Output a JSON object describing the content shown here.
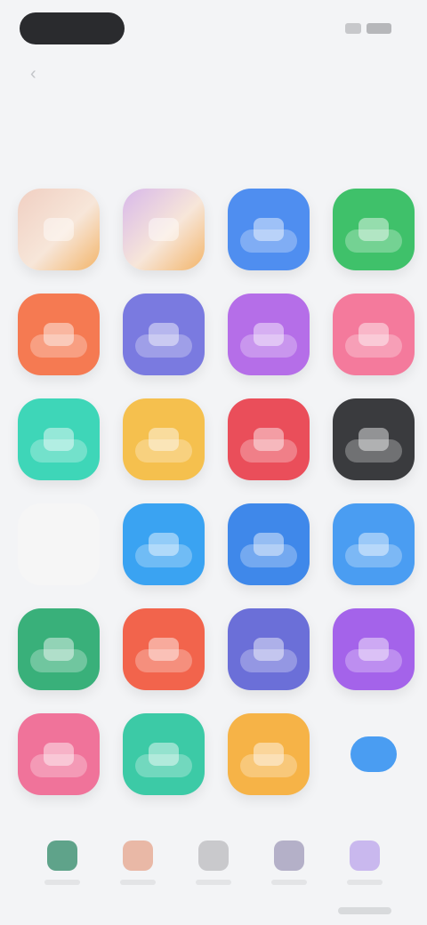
{
  "page": {
    "title": ""
  },
  "tiles": [
    {
      "name": "app-tile-1-1",
      "color": "#f0cfc2",
      "style": "illustrated"
    },
    {
      "name": "app-tile-1-2",
      "color": "#d8b8ea",
      "style": "illustrated"
    },
    {
      "name": "app-tile-1-3",
      "color": "#4f8ef0",
      "style": "solid"
    },
    {
      "name": "app-tile-1-4",
      "color": "#3fc16a",
      "style": "solid"
    },
    {
      "name": "app-tile-2-1",
      "color": "#f57a52",
      "style": "solid"
    },
    {
      "name": "app-tile-2-2",
      "color": "#7a7ae0",
      "style": "solid"
    },
    {
      "name": "app-tile-2-3",
      "color": "#b56ee8",
      "style": "solid"
    },
    {
      "name": "app-tile-2-4",
      "color": "#f47a9c",
      "style": "solid"
    },
    {
      "name": "app-tile-3-1",
      "color": "#3ed6b8",
      "style": "solid"
    },
    {
      "name": "app-tile-3-2",
      "color": "#f5c04e",
      "style": "solid"
    },
    {
      "name": "app-tile-3-3",
      "color": "#ea4e5a",
      "style": "solid"
    },
    {
      "name": "app-tile-3-4",
      "color": "#3a3b3e",
      "style": "solid"
    },
    {
      "name": "app-tile-4-1",
      "color": "#f6f6f6",
      "style": "blank"
    },
    {
      "name": "app-tile-4-2",
      "color": "#3aa3f2",
      "style": "solid"
    },
    {
      "name": "app-tile-4-3",
      "color": "#3f88ea",
      "style": "solid"
    },
    {
      "name": "app-tile-4-4",
      "color": "#4a9df2",
      "style": "solid"
    },
    {
      "name": "app-tile-5-1",
      "color": "#39b07a",
      "style": "solid"
    },
    {
      "name": "app-tile-5-2",
      "color": "#f2644c",
      "style": "solid"
    },
    {
      "name": "app-tile-5-3",
      "color": "#6b6fd8",
      "style": "solid"
    },
    {
      "name": "app-tile-5-4",
      "color": "#a463ea",
      "style": "solid"
    },
    {
      "name": "app-tile-6-1",
      "color": "#f0739a",
      "style": "solid"
    },
    {
      "name": "app-tile-6-2",
      "color": "#3ccaa6",
      "style": "solid"
    },
    {
      "name": "app-tile-6-3",
      "color": "#f6b347",
      "style": "solid"
    },
    {
      "name": "app-tile-6-4",
      "color": "#4a9df2",
      "style": "dot"
    }
  ],
  "dock": [
    {
      "name": "dock-item-1",
      "color": "#5fa38a"
    },
    {
      "name": "dock-item-2",
      "color": "#e9b8a6"
    },
    {
      "name": "dock-item-3",
      "color": "#c9c9cc"
    },
    {
      "name": "dock-item-4",
      "color": "#b4b0c8"
    },
    {
      "name": "dock-item-5",
      "color": "#c9b8ee"
    }
  ]
}
